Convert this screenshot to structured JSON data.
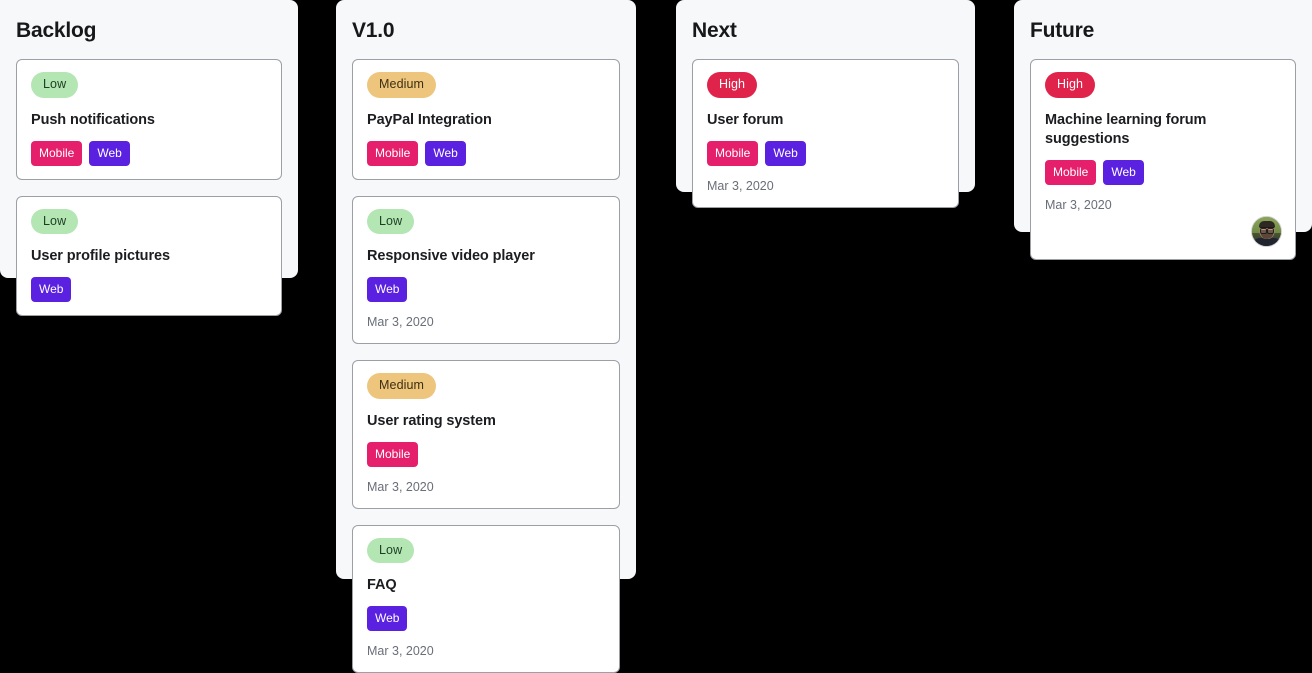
{
  "board": {
    "background_color": "#000000",
    "column_background": "#f7f8f9",
    "columns": [
      {
        "title": "Backlog",
        "cards": [
          {
            "priority": "Low",
            "priority_level": "low",
            "title": "Push notifications",
            "tags": [
              "Mobile",
              "Web"
            ],
            "date": "",
            "has_avatar": false
          },
          {
            "priority": "Low",
            "priority_level": "low",
            "title": "User profile pictures",
            "tags": [
              "Web"
            ],
            "date": "",
            "has_avatar": false
          }
        ]
      },
      {
        "title": "V1.0",
        "cards": [
          {
            "priority": "Medium",
            "priority_level": "medium",
            "title": "PayPal Integration",
            "tags": [
              "Mobile",
              "Web"
            ],
            "date": "",
            "has_avatar": false
          },
          {
            "priority": "Low",
            "priority_level": "low",
            "title": "Responsive video player",
            "tags": [
              "Web"
            ],
            "date": "Mar 3, 2020",
            "has_avatar": false
          },
          {
            "priority": "Medium",
            "priority_level": "medium",
            "title": "User rating system",
            "tags": [
              "Mobile"
            ],
            "date": "Mar 3, 2020",
            "has_avatar": false
          },
          {
            "priority": "Low",
            "priority_level": "low",
            "title": "FAQ",
            "tags": [
              "Web"
            ],
            "date": "Mar 3, 2020",
            "has_avatar": false
          }
        ]
      },
      {
        "title": "Next",
        "cards": [
          {
            "priority": "High",
            "priority_level": "high",
            "title": "User forum",
            "tags": [
              "Mobile",
              "Web"
            ],
            "date": "Mar 3, 2020",
            "has_avatar": false
          }
        ]
      },
      {
        "title": "Future",
        "cards": [
          {
            "priority": "High",
            "priority_level": "high",
            "title": "Machine learning forum suggestions",
            "tags": [
              "Mobile",
              "Web"
            ],
            "date": "Mar 3, 2020",
            "has_avatar": true,
            "avatar_name": "user-avatar"
          }
        ]
      }
    ],
    "priority_colors": {
      "low_bg": "#b3e6b3",
      "low_text": "#1d3d22",
      "medium_bg": "#eec57c",
      "medium_text": "#3d2f12",
      "high_bg": "#e0234a",
      "high_text": "#ffffff"
    },
    "tag_colors": {
      "Mobile": "#e51f6b",
      "Web": "#5a21e0"
    },
    "date_text_color": "#696e78"
  }
}
